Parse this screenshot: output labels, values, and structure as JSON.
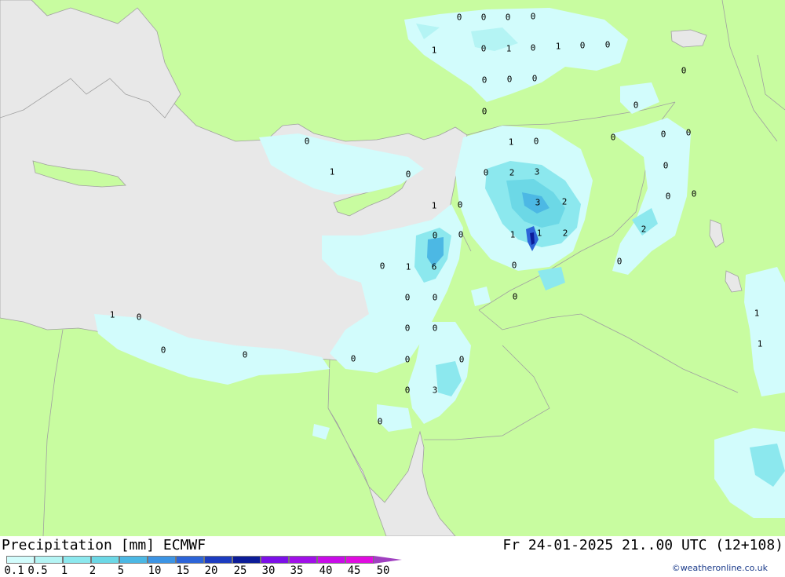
{
  "title": {
    "left": "Precipitation [mm] ECMWF",
    "right": "Fr 24-01-2025 21..00 UTC (12+108)"
  },
  "credit": "©weatheronline.co.uk",
  "legend": {
    "ticks": [
      "0.1",
      "0.5",
      "1",
      "2",
      "5",
      "10",
      "15",
      "20",
      "25",
      "30",
      "35",
      "40",
      "45",
      "50"
    ],
    "colors": [
      "#d2fcfc",
      "#b4f4f4",
      "#8ce8ee",
      "#6cd8e6",
      "#4cb8e4",
      "#3c94e4",
      "#2c64d8",
      "#1c3cc0",
      "#0c1c98",
      "#7c10e8",
      "#a010e8",
      "#c80ce8",
      "#e00ce0",
      "#c014b8"
    ],
    "arrow_color": "#a040c0"
  },
  "map_colors": {
    "land": "#c8fca0",
    "sea": "#e8e8e8",
    "border": "#a0a0a0"
  },
  "map_labels": [
    "0",
    "0",
    "0",
    "0",
    "1",
    "0",
    "1",
    "0",
    "1",
    "0",
    "0",
    "0",
    "0",
    "0",
    "0",
    "0",
    "0",
    "1",
    "0",
    "0",
    "0",
    "0",
    "0",
    "2",
    "3",
    "0",
    "1",
    "0",
    "1",
    "3",
    "2",
    "0",
    "0",
    "0",
    "1",
    "1",
    "2",
    "2",
    "0",
    "1",
    "6",
    "0",
    "0",
    "0",
    "0",
    "0",
    "0",
    "0",
    "0",
    "1",
    "0",
    "1",
    "0",
    "0",
    "0",
    "1",
    "0",
    "0",
    "0",
    "0",
    "0",
    "3",
    "0"
  ]
}
